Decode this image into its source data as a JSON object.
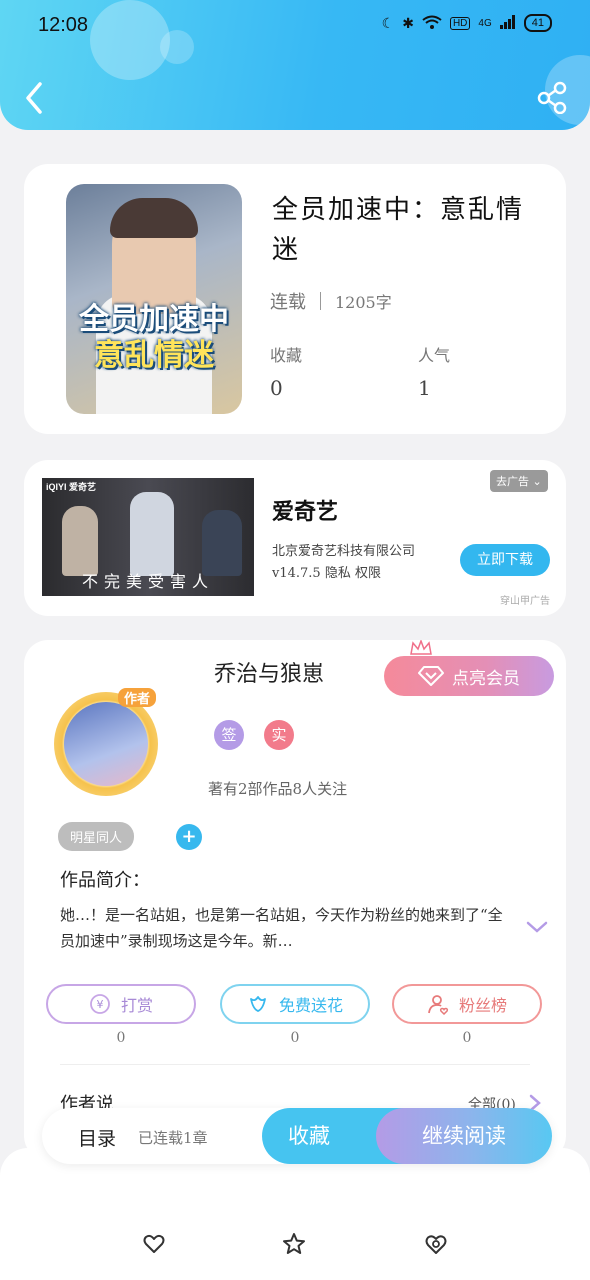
{
  "status_bar": {
    "time": "12:08",
    "network": "4G",
    "battery": "41"
  },
  "book": {
    "title": "全员加速中：意乱情迷",
    "cover_text_line1": "全员加速中",
    "cover_text_line2": "意乱情迷",
    "status": "连载",
    "words": "1205字",
    "favorites_label": "收藏",
    "favorites_value": "0",
    "popularity_label": "人气",
    "popularity_value": "1"
  },
  "ad": {
    "image_caption": "不完美受害人",
    "logo_text": "iQIYI 爱奇艺",
    "title": "爱奇艺",
    "company": "北京爱奇艺科技有限公司",
    "version_line": "v14.7.5  隐私  权限",
    "remove_ad_label": "去广告",
    "download_label": "立即下载",
    "source": "穿山甲广告"
  },
  "author": {
    "name": "乔治与狼崽",
    "badge": "作者",
    "vip_label": "点亮会员",
    "sign_badge_1": "签",
    "sign_badge_2": "实",
    "stats": "著有2部作品8人关注",
    "tag": "明星同人",
    "add_tag": "+",
    "intro_label": "作品简介：",
    "intro_text": "她…！是一名站姐，也是第一名站姐，今天作为粉丝的她来到了“全员加速中”录制现场这是今年。新…",
    "actions": [
      {
        "label": "打赏",
        "count": "0",
        "icon": "coin-icon"
      },
      {
        "label": "免费送花",
        "count": "0",
        "icon": "flower-icon"
      },
      {
        "label": "粉丝榜",
        "count": "0",
        "icon": "fan-ranking-icon"
      }
    ],
    "author_says_label": "作者说",
    "all_label": "全部(0)"
  },
  "action_bar": {
    "toc_label": "目录",
    "toc_count": "已连载1章",
    "favorite_label": "收藏",
    "continue_label": "继续阅读"
  },
  "bottom_nav": [
    "heart-icon",
    "star-icon",
    "heart-badge-icon"
  ],
  "colors": {
    "header_gradient_start": "#5fd6f3",
    "header_gradient_end": "#2fb0f3",
    "accent_blue": "#37b8ee",
    "vip_pink": "#f58a9a",
    "purple": "#b49be6"
  }
}
